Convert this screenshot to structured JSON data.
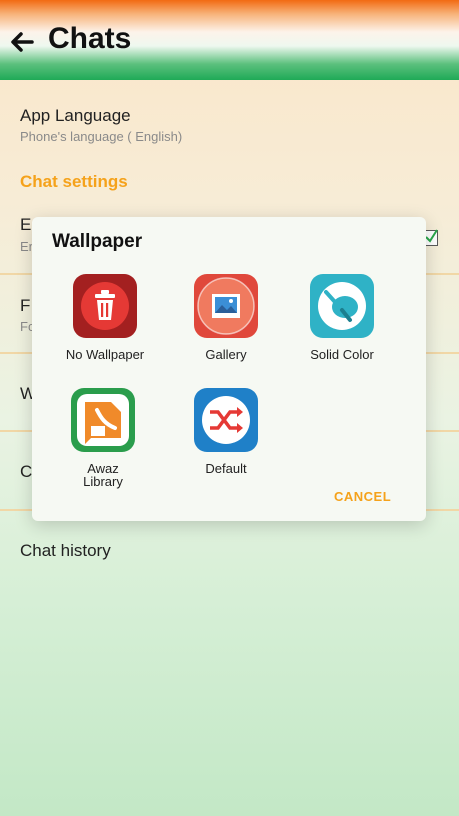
{
  "header": {
    "title": "Chats"
  },
  "settings": {
    "app_language": {
      "title": "App Language",
      "subtitle": "Phone's language ( English)"
    },
    "section_chat": "Chat settings",
    "row_e": {
      "title": "E",
      "subtitle": "Er",
      "checked": true
    },
    "row_f": {
      "title": "F",
      "subtitle": "Fc"
    },
    "row_w": {
      "title": "W"
    },
    "row_c": {
      "title": "C"
    },
    "chat_history": {
      "title": "Chat history"
    }
  },
  "dialog": {
    "title": "Wallpaper",
    "options": [
      {
        "label": "No Wallpaper",
        "icon": "trash-icon"
      },
      {
        "label": "Gallery",
        "icon": "gallery-icon"
      },
      {
        "label": "Solid Color",
        "icon": "palette-icon"
      },
      {
        "label": "Awaz\nLibrary",
        "icon": "awaz-library-icon"
      },
      {
        "label": "Default",
        "icon": "shuffle-icon"
      }
    ],
    "cancel": "CANCEL"
  },
  "colors": {
    "accent_orange": "#f5a21b",
    "saffron": "#f26a12",
    "green": "#1faa57"
  }
}
